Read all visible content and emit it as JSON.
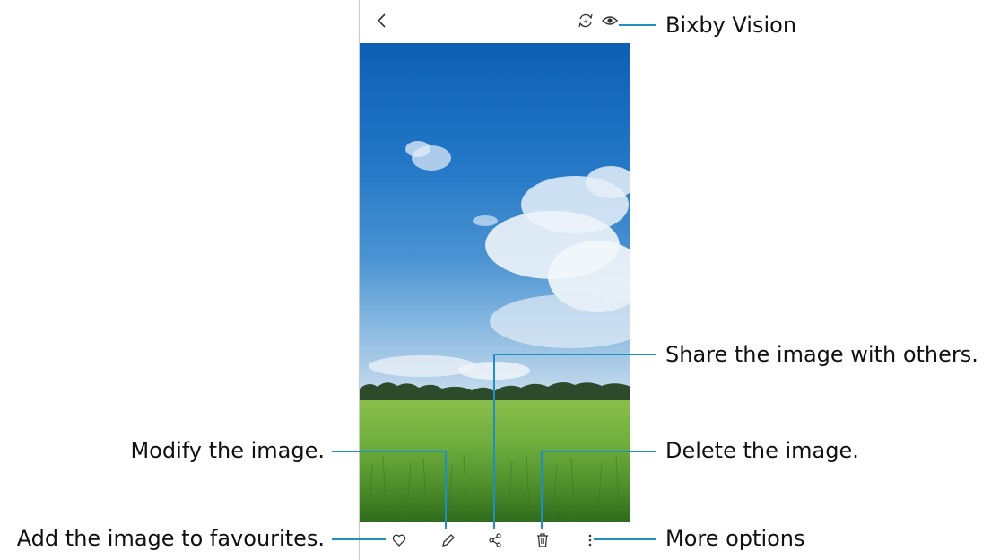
{
  "callouts": {
    "bixby_vision": "Bixby Vision",
    "share": "Share the image with others.",
    "modify": "Modify the image.",
    "delete": "Delete the image.",
    "favourites": "Add the image to favourites.",
    "more_options": "More options"
  },
  "icons": {
    "back": "back-arrow-icon",
    "remaster": "remaster-icon",
    "bixby_vision": "eye-icon",
    "favourite": "heart-icon",
    "edit": "pencil-icon",
    "share": "share-icon",
    "delete": "trash-icon",
    "more": "more-vertical-icon"
  },
  "colors": {
    "callout_line": "#1e8dc8",
    "sky_top": "#0c5fb3",
    "field": "#6fae3e"
  }
}
